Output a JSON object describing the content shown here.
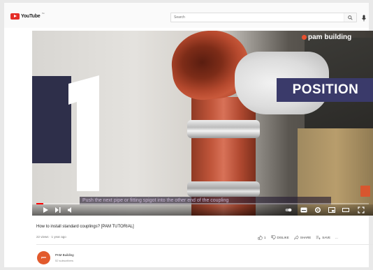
{
  "masthead": {
    "logo_text": "YouTube",
    "logo_reg": "™",
    "search_placeholder": "Search"
  },
  "video": {
    "brand_text": "pam building",
    "big_numeral": "1",
    "overlay_word": "POSITION",
    "caption_text": "Push the next pipe or fitting spigot into the other end of the coupling",
    "progress": 0.02
  },
  "info": {
    "title": "How to install standard couplings? [PAM TUTORIAL]",
    "meta": "22 views · 1 year ago",
    "actions": {
      "like_count": "1",
      "dislike_label": "DISLIKE",
      "share_label": "SHARE",
      "save_label": "SAVE",
      "more_label": "..."
    }
  },
  "channel": {
    "name": "PAM Building",
    "subscribers": "52 subscribers",
    "avatar_text": "pam"
  },
  "colors": {
    "youtube_red": "#e52d27",
    "overlay_navy": "#3a3a6a",
    "pipe_orange": "#c0553a",
    "brand_orange": "#e8502f"
  }
}
